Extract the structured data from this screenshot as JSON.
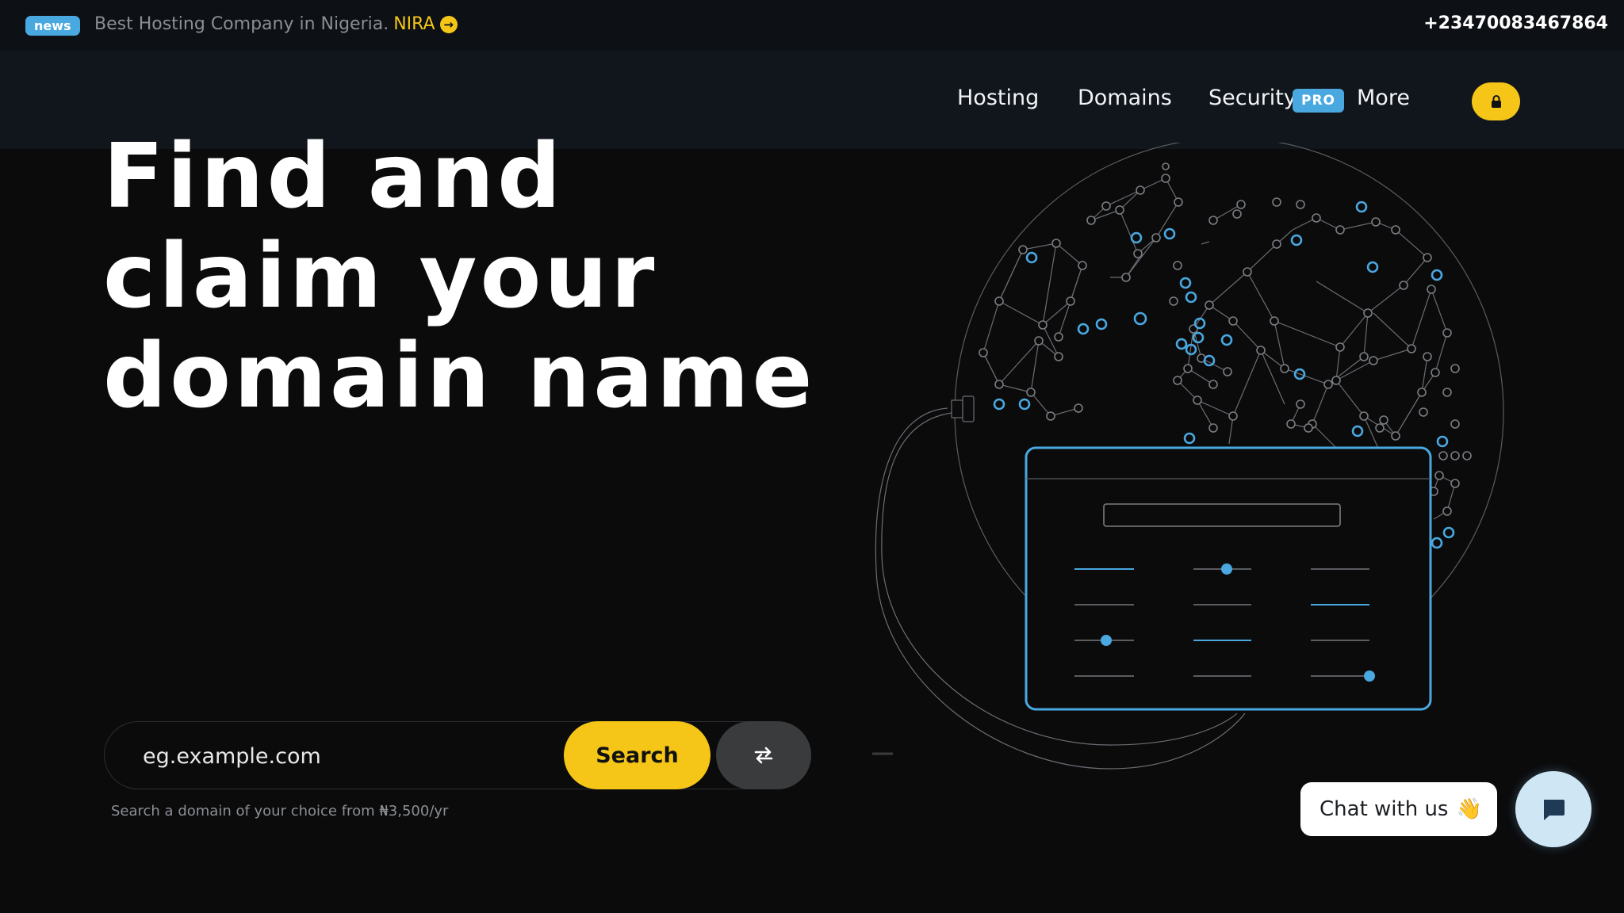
{
  "topbar": {
    "badge": "news",
    "announcement": "Best Hosting Company in Nigeria.",
    "link_text": "NIRA",
    "phone": "+23470083467864"
  },
  "nav": {
    "items": [
      {
        "label": "Hosting"
      },
      {
        "label": "Domains"
      },
      {
        "label": "Security"
      },
      {
        "label": "More"
      }
    ],
    "pro_badge": "PRO",
    "lock_icon": "lock-icon"
  },
  "hero": {
    "lines": [
      "Find and",
      "claim your",
      "domain name"
    ]
  },
  "search": {
    "placeholder": "eg.example.com",
    "button": "Search",
    "swap_icon": "swap-arrows-icon",
    "hint": "Search a domain of your choice from ₦3,500/yr"
  },
  "chat": {
    "label": "Chat with us",
    "emoji": "👋",
    "icon": "chat-bubble-icon"
  },
  "colors": {
    "accent_yellow": "#f5c518",
    "accent_blue": "#4aa8e0",
    "background": "#0b0b0c",
    "navbar": "#11161d"
  }
}
